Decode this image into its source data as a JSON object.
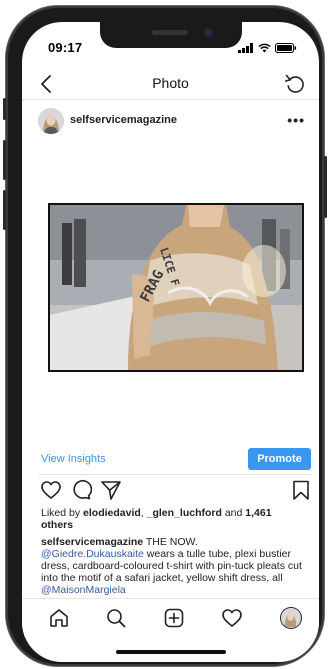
{
  "status_bar": {
    "time": "09:17"
  },
  "header": {
    "title": "Photo"
  },
  "post": {
    "username": "selfservicemagazine",
    "more": "•••",
    "view_insights": "View Insights",
    "promote": "Promote",
    "likes_prefix": "Liked by ",
    "liker_1": "elodiedavid",
    "liker_sep": ", ",
    "liker_2": "_glen_luchford",
    "likes_and": " and ",
    "likes_count": "1,461",
    "likes_suffix": "others",
    "caption_user": "selfservicemagazine",
    "caption_lead": " THE NOW.",
    "caption_mention_1": "@Giedre.Dukauskaite",
    "caption_body": " wears a tulle tube, plexi bustier dress, cardboard-coloured t-shirt with pin-tuck pleats cut into the motif of a safari jacket, yellow shift dress, all ",
    "caption_mention_2": "@MaisonMargiela"
  },
  "icons": {
    "back": "chevron-left-icon",
    "refresh": "refresh-icon",
    "like": "heart-icon",
    "comment": "comment-bubble-icon",
    "share": "paper-plane-icon",
    "save": "bookmark-icon",
    "home": "home-icon",
    "search": "search-icon",
    "create": "plus-square-icon",
    "activity": "heart-icon",
    "profile": "profile-avatar-icon"
  },
  "colors": {
    "link": "#3897f0",
    "mention": "#3b5998",
    "text": "#222222"
  }
}
